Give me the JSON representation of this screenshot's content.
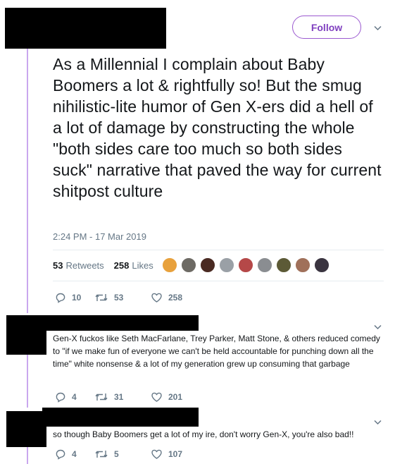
{
  "header": {
    "follow_label": "Follow"
  },
  "main_tweet": {
    "text": "As a Millennial I complain about Baby Boomers a lot & rightfully so! But the smug nihilistic-lite humor of Gen X-ers did a hell of a lot of damage by constructing the whole \"both sides care too much so both sides suck\" narrative that paved the way for current shitpost culture",
    "timestamp": "2:24 PM - 17 Mar 2019",
    "retweets_count": "53",
    "retweets_label": "Retweets",
    "likes_count": "258",
    "likes_label": "Likes",
    "actions": {
      "replies": "10",
      "retweets": "53",
      "likes": "258"
    },
    "liker_avatar_colors": [
      "#e8a13c",
      "#6d6a64",
      "#4a2a22",
      "#9aa0a6",
      "#b54848",
      "#8a8d91",
      "#5c5a36",
      "#a0705a",
      "#3a3440"
    ]
  },
  "replies": [
    {
      "text": "Gen-X fuckos like Seth MacFarlane, Trey Parker, Matt Stone, & others reduced comedy to \"if we make fun of everyone we can't be held accountable for punching down all the time\" white nonsense & a lot of my generation grew up consuming that garbage",
      "actions": {
        "replies": "4",
        "retweets": "31",
        "likes": "201"
      }
    },
    {
      "text": "so though Baby Boomers get a lot of my ire, don't worry Gen-X, you're also bad!!",
      "actions": {
        "replies": "4",
        "retweets": "5",
        "likes": "107"
      }
    }
  ],
  "colors": {
    "accent": "#7f3fbf",
    "thread_line": "#c9a7ee",
    "muted_text": "#657786",
    "redaction": "#000000"
  }
}
